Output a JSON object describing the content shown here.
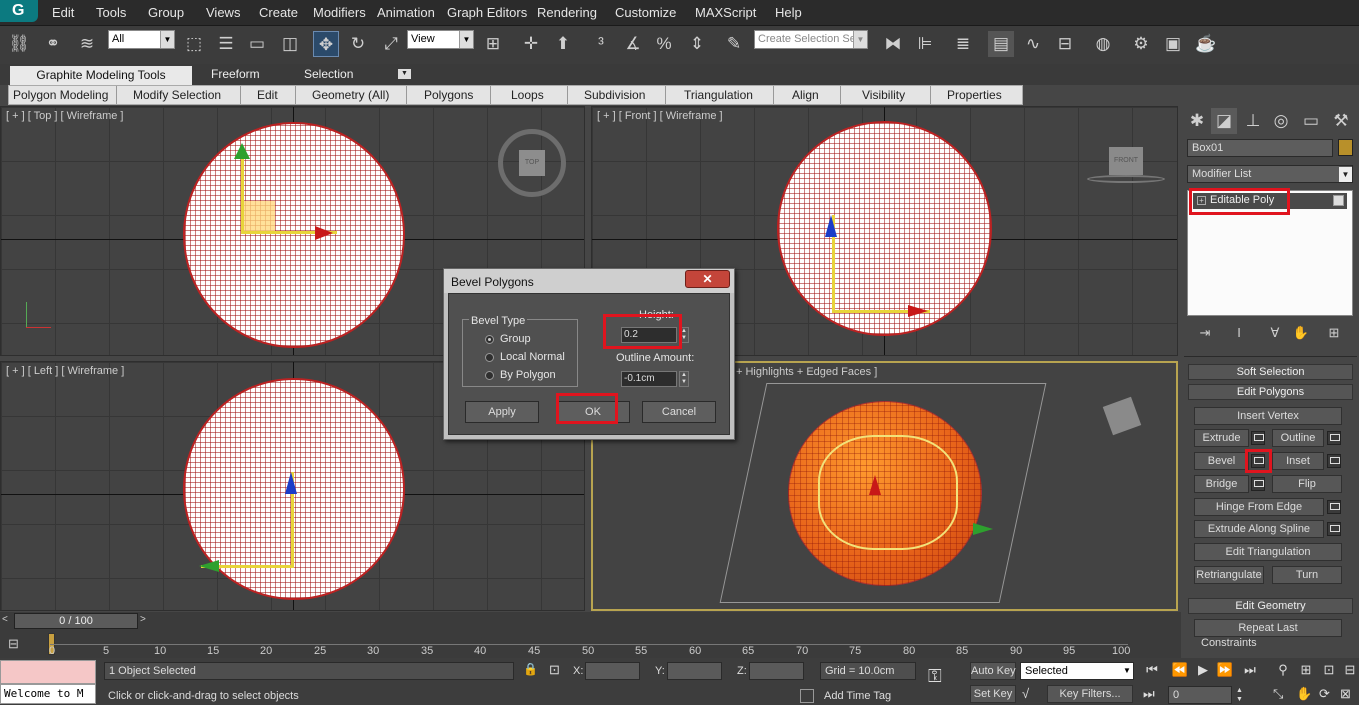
{
  "menu": [
    "Edit",
    "Tools",
    "Group",
    "Views",
    "Create",
    "Modifiers",
    "Animation",
    "Graph Editors",
    "Rendering",
    "Customize",
    "MAXScript",
    "Help"
  ],
  "toolbar": {
    "selection_filter": "All",
    "ref_coord": "View",
    "named_selection_placeholder": "Create Selection Se"
  },
  "ribbon": {
    "tabs": [
      "Graphite Modeling Tools",
      "Freeform",
      "Selection"
    ],
    "panels": [
      "Polygon Modeling",
      "Modify Selection",
      "Edit",
      "Geometry (All)",
      "Polygons",
      "Loops",
      "Subdivision",
      "Triangulation",
      "Align",
      "Visibility",
      "Properties"
    ]
  },
  "viewports": {
    "top": {
      "label": "[ + ] [ Top ] [ Wireframe ]",
      "cube": "TOP"
    },
    "front": {
      "label": "[ + ] [ Front ] [ Wireframe ]",
      "cube": "FRONT"
    },
    "left": {
      "label": "[ + ] [ Left ] [ Wireframe ]"
    },
    "persp": {
      "label": "+ Highlights + Edged Faces ]"
    }
  },
  "dialog": {
    "title": "Bevel Polygons",
    "close": "✕",
    "group_label": "Bevel Type",
    "options": [
      "Group",
      "Local Normal",
      "By Polygon"
    ],
    "selected_option": "Group",
    "height_label": "Height:",
    "height_value": "0.2",
    "outline_label": "Outline Amount:",
    "outline_value": "-0.1cm",
    "apply": "Apply",
    "ok": "OK",
    "cancel": "Cancel"
  },
  "command_panel": {
    "object_name": "Box01",
    "object_color": "#b8902a",
    "modifier_list": "Modifier List",
    "stack_item": "Editable Poly",
    "rollouts": {
      "soft_selection": "Soft Selection",
      "edit_polygons": "Edit Polygons",
      "edit_geometry": "Edit Geometry"
    },
    "buttons": {
      "insert_vertex": "Insert Vertex",
      "extrude": "Extrude",
      "outline": "Outline",
      "bevel": "Bevel",
      "inset": "Inset",
      "bridge": "Bridge",
      "flip": "Flip",
      "hinge": "Hinge From Edge",
      "extrude_spline": "Extrude Along Spline",
      "edit_tri": "Edit Triangulation",
      "retriangulate": "Retriangulate",
      "turn": "Turn",
      "repeat_last": "Repeat Last",
      "constraints": "Constraints"
    }
  },
  "timeline": {
    "position": "0 / 100",
    "ticks": [
      "0",
      "5",
      "10",
      "15",
      "20",
      "25",
      "30",
      "35",
      "40",
      "45",
      "50",
      "55",
      "60",
      "65",
      "70",
      "75",
      "80",
      "85",
      "90",
      "95",
      "100"
    ]
  },
  "status": {
    "selected": "1 Object Selected",
    "prompt": "Click or click-and-drag to select objects",
    "maxscript": "Welcome to M",
    "x_label": "X:",
    "y_label": "Y:",
    "z_label": "Z:",
    "grid": "Grid = 10.0cm",
    "add_time_tag": "Add Time Tag",
    "auto_key": "Auto Key",
    "set_key": "Set Key",
    "key_mode": "Selected",
    "key_filters": "Key Filters...",
    "frame": "0"
  },
  "colors": {
    "highlight": "#e0141e",
    "selected_sphere": "#e8641a"
  }
}
